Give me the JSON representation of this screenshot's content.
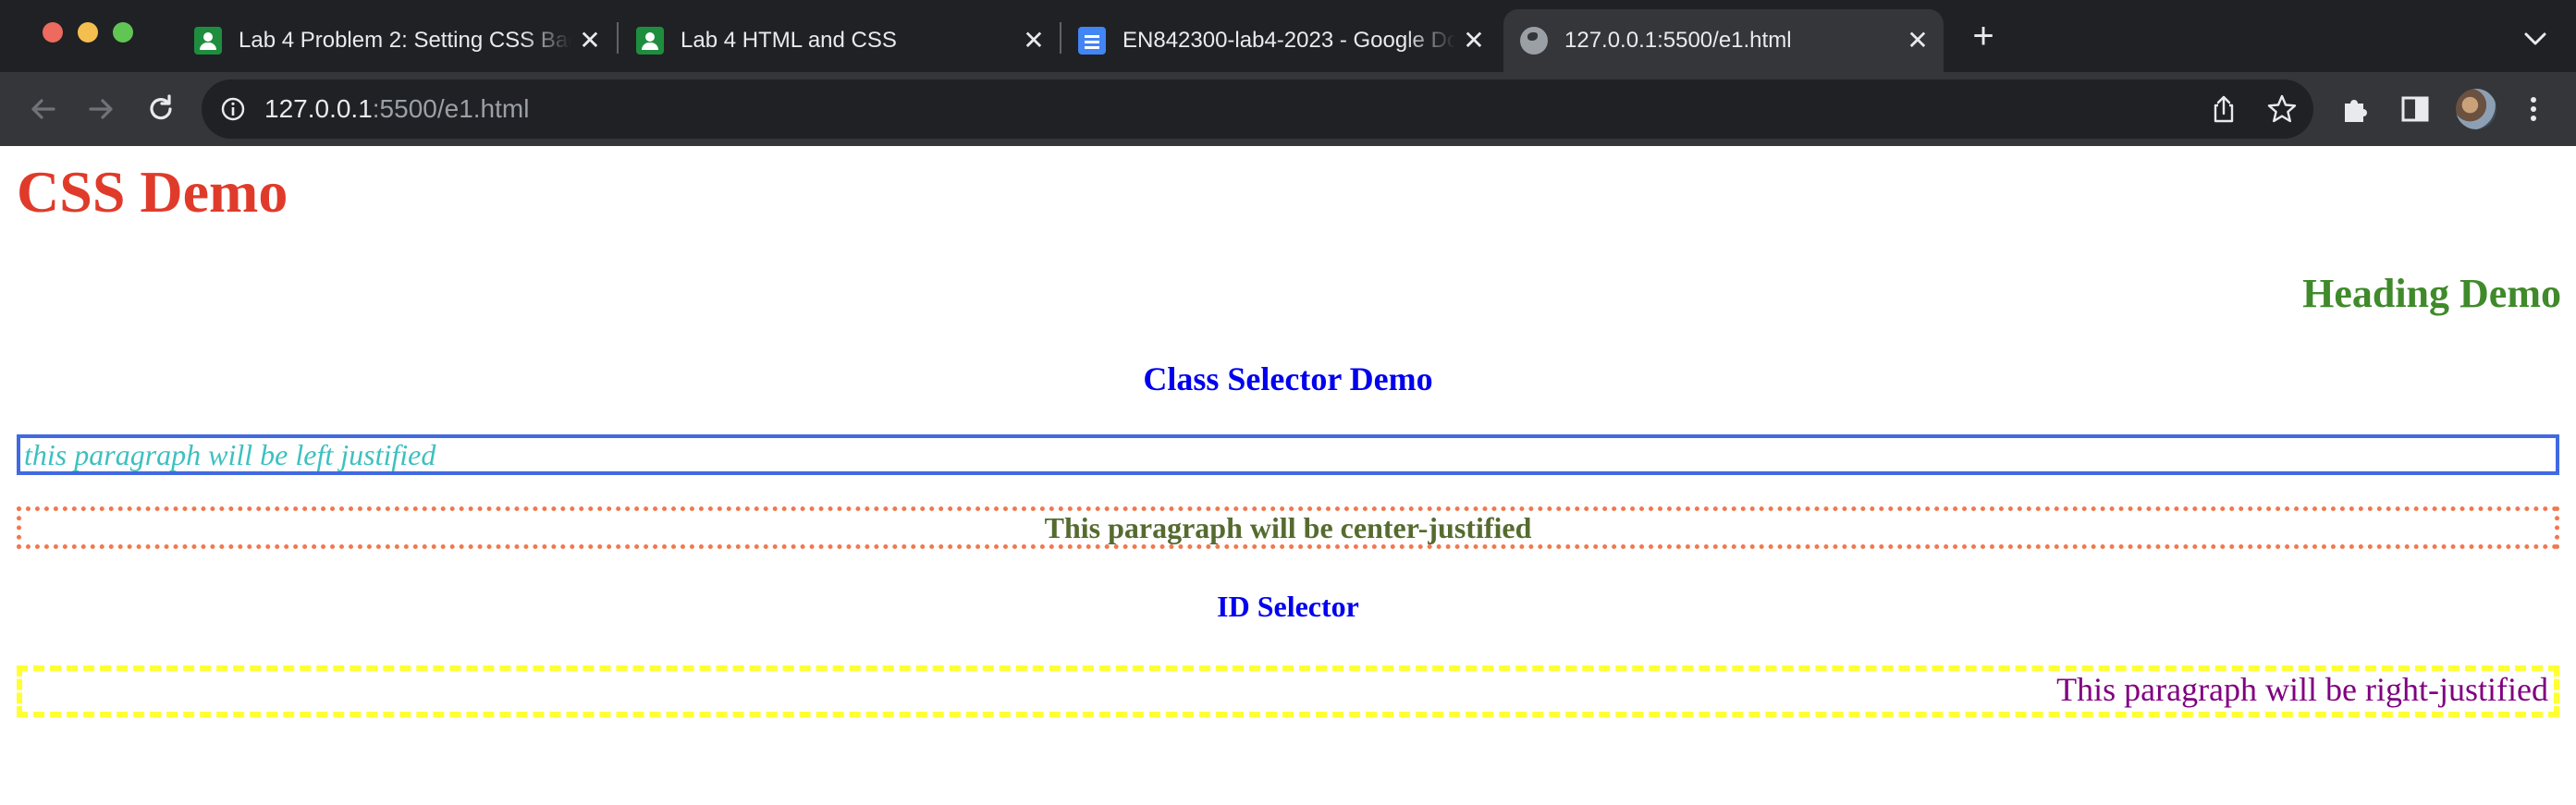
{
  "browser": {
    "tabs": [
      {
        "title": "Lab 4 Problem 2: Setting CSS Background",
        "icon": "classroom-icon",
        "active": false
      },
      {
        "title": "Lab 4 HTML and CSS",
        "icon": "classroom-icon",
        "active": false
      },
      {
        "title": "EN842300-lab4-2023 - Google Docs",
        "icon": "docs-icon",
        "active": false
      },
      {
        "title": "127.0.0.1:5500/e1.html",
        "icon": "globe-icon",
        "active": true
      }
    ],
    "close_glyph": "✕",
    "new_tab_glyph": "+",
    "address": {
      "host": "127.0.0.1",
      "path": ":5500/e1.html"
    },
    "colors": {
      "chrome_dark": "#202124",
      "chrome_toolbar": "#35363a"
    }
  },
  "page": {
    "h1": "CSS Demo",
    "h2": "Heading Demo",
    "class_selector_heading": "Class Selector Demo",
    "left_paragraph": "this paragraph will be left justified",
    "center_paragraph": "This paragraph will be center-justified",
    "id_selector_heading": "ID Selector",
    "right_paragraph": "This paragraph will be right-justified",
    "colors": {
      "h1": "#e03b2a",
      "h2": "#3f8a2a",
      "headings_blue": "#0000ee",
      "left_text": "#3ec0c0",
      "left_border": "#4169e1",
      "center_text": "#556b2f",
      "center_border": "#f07850",
      "right_text": "#800080",
      "right_border": "#ffff33"
    }
  }
}
